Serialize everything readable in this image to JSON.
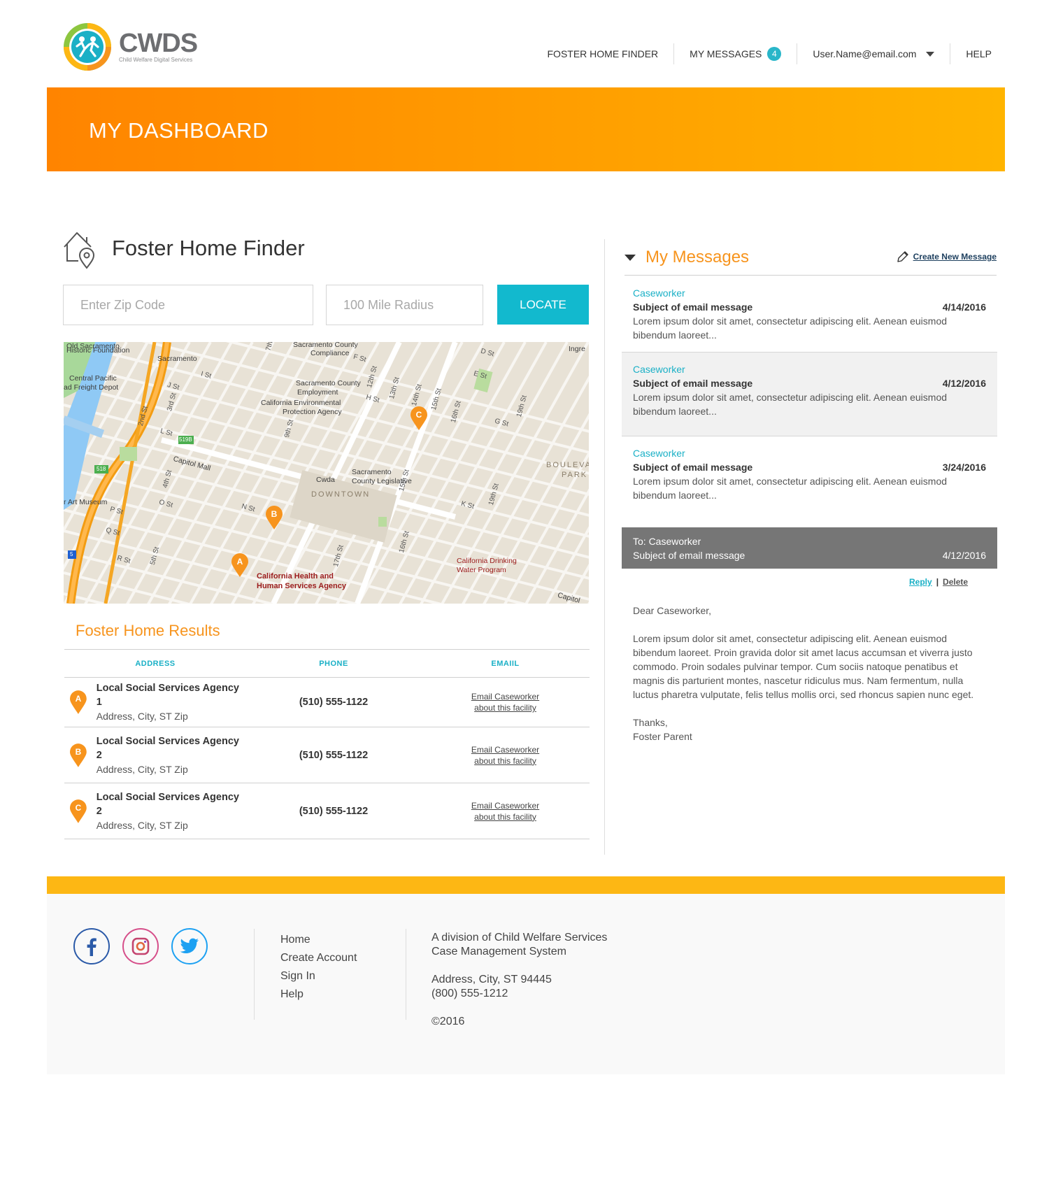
{
  "brand": {
    "name": "CWDS",
    "tagline": "Child Welfare Digital Services"
  },
  "nav": {
    "finder": "FOSTER HOME FINDER",
    "messages": "MY MESSAGES",
    "messages_count": "4",
    "user": "User.Name@email.com",
    "help": "HELP"
  },
  "banner": {
    "title": "MY DASHBOARD"
  },
  "finder": {
    "title": "Foster Home Finder",
    "zip_placeholder": "Enter Zip Code",
    "radius_placeholder": "100 Mile Radius",
    "locate_label": "LOCATE",
    "map": {
      "labels": {
        "historic": "Historic Foundation",
        "old_sac": "Old Sacramento",
        "sacramento": "Sacramento",
        "county_compliance_1": "Sacramento County",
        "county_compliance_2": "Compliance",
        "central_pacific_1": "Central Pacific",
        "central_pacific_2": "ad Freight Depot",
        "county_employment_1": "Sacramento County",
        "county_employment_2": "Employment",
        "env_1": "California Environmental",
        "env_2": "Protection Agency",
        "capitol_mall": "Capitol Mall",
        "cwda": "Cwda",
        "county_leg_1": "Sacramento",
        "county_leg_2": "County Legislative",
        "downtown": "DOWNTOWN",
        "art_museum": "r Art Museum",
        "boulevard_1": "BOULEVA",
        "boulevard_2": "PARK",
        "ingre": "Ingre",
        "chhs_1": "California Health and",
        "chhs_2": "Human Services Agency",
        "water_1": "California Drinking",
        "water_2": "Water Program",
        "capitol": "Capitol",
        "hwy_519b": "519B",
        "hwy_518": "518",
        "hwy_5": "5"
      },
      "streets": {
        "s2nd": "2nd St",
        "s3rd": "3rd St",
        "s4th": "4th St",
        "s5th": "5th St",
        "s7th": "7th",
        "s9th": "9th St",
        "s12th": "12th St",
        "s13th": "13th St",
        "s14th": "14th St",
        "s15th_a": "15th St",
        "s15th_b": "15th St",
        "s16th_a": "16th St",
        "s16th_b": "16th St",
        "s17th": "17th St",
        "s19th_a": "19th St",
        "s19th_b": "19th St",
        "j": "J St",
        "i": "I St",
        "h": "H St",
        "k": "K St",
        "l": "L St",
        "n": "N St",
        "o": "O St",
        "p": "P St",
        "q": "Q St",
        "r": "R St",
        "d": "D St",
        "e": "E St",
        "f": "F St",
        "g": "G St"
      },
      "pins": [
        "A",
        "B",
        "C"
      ]
    }
  },
  "results": {
    "title": "Foster Home Results",
    "columns": {
      "address": "ADDRESS",
      "phone": "PHONE",
      "email": "EMAIIL"
    },
    "rows": [
      {
        "pin": "A",
        "name": "Local Social Services Agency 1",
        "address": "Address, City, ST Zip",
        "phone": "(510) 555-1122",
        "email_1": "Email Caseworker",
        "email_2": "about this facility"
      },
      {
        "pin": "B",
        "name": "Local Social Services Agency 2",
        "address": "Address, City, ST Zip",
        "phone": "(510) 555-1122",
        "email_1": "Email Caseworker",
        "email_2": "about this facility"
      },
      {
        "pin": "C",
        "name": "Local Social Services Agency 2",
        "address": "Address, City, ST Zip",
        "phone": "(510) 555-1122",
        "email_1": "Email Caseworker",
        "email_2": "about this facility"
      }
    ]
  },
  "messages": {
    "title": "My Messages",
    "create_label": "Create New Message",
    "items": [
      {
        "from": "Caseworker",
        "subject": "Subject of email message",
        "date": "4/14/2016",
        "preview_1": "Lorem ipsum dolor sit amet, consectetur adipiscing elit. Aenean euismod",
        "preview_2": "bibendum laoreet..."
      },
      {
        "from": "Caseworker",
        "subject": "Subject of email message",
        "date": "4/12/2016",
        "preview_1": "Lorem ipsum dolor sit amet, consectetur adipiscing elit. Aenean euismod",
        "preview_2": "bibendum laoreet..."
      },
      {
        "from": "Caseworker",
        "subject": "Subject of email message",
        "date": "3/24/2016",
        "preview_1": "Lorem ipsum dolor sit amet, consectetur adipiscing elit. Aenean euismod",
        "preview_2": "bibendum laoreet..."
      }
    ],
    "open": {
      "to": "To: Caseworker",
      "subject": "Subject of email message",
      "date": "4/12/2016",
      "reply_label": "Reply",
      "separator": "|",
      "delete_label": "Delete",
      "greeting": "Dear Caseworker,",
      "body": "Lorem ipsum dolor sit amet, consectetur adipiscing elit. Aenean euismod bibendum laoreet. Proin gravida dolor sit amet lacus accumsan et viverra justo commodo. Proin sodales pulvinar tempor. Cum sociis natoque penatibus et magnis dis parturient montes, nascetur ridiculus mus. Nam fermentum, nulla luctus pharetra vulputate, felis tellus mollis orci, sed rhoncus sapien nunc eget.",
      "closing": "Thanks,",
      "signature": "Foster Parent"
    }
  },
  "footer": {
    "links": [
      "Home",
      "Create Account",
      "Sign In",
      "Help"
    ],
    "division_1": "A division of Child Welfare Services",
    "division_2": "Case Management System",
    "address": "Address, City, ST 94445",
    "phone": "(800) 555-1212",
    "copyright": "©2016"
  },
  "colors": {
    "accent_orange": "#f7941d",
    "banner_start": "#ff8400",
    "banner_end": "#ffb400",
    "teal": "#12b9ce",
    "footer_bar": "#fdb714"
  },
  "icons": {
    "logo": "cwds-logo-icon",
    "finder": "house-pin-icon",
    "compose": "pencil-icon",
    "social": [
      "facebook-icon",
      "instagram-icon",
      "twitter-icon"
    ]
  }
}
